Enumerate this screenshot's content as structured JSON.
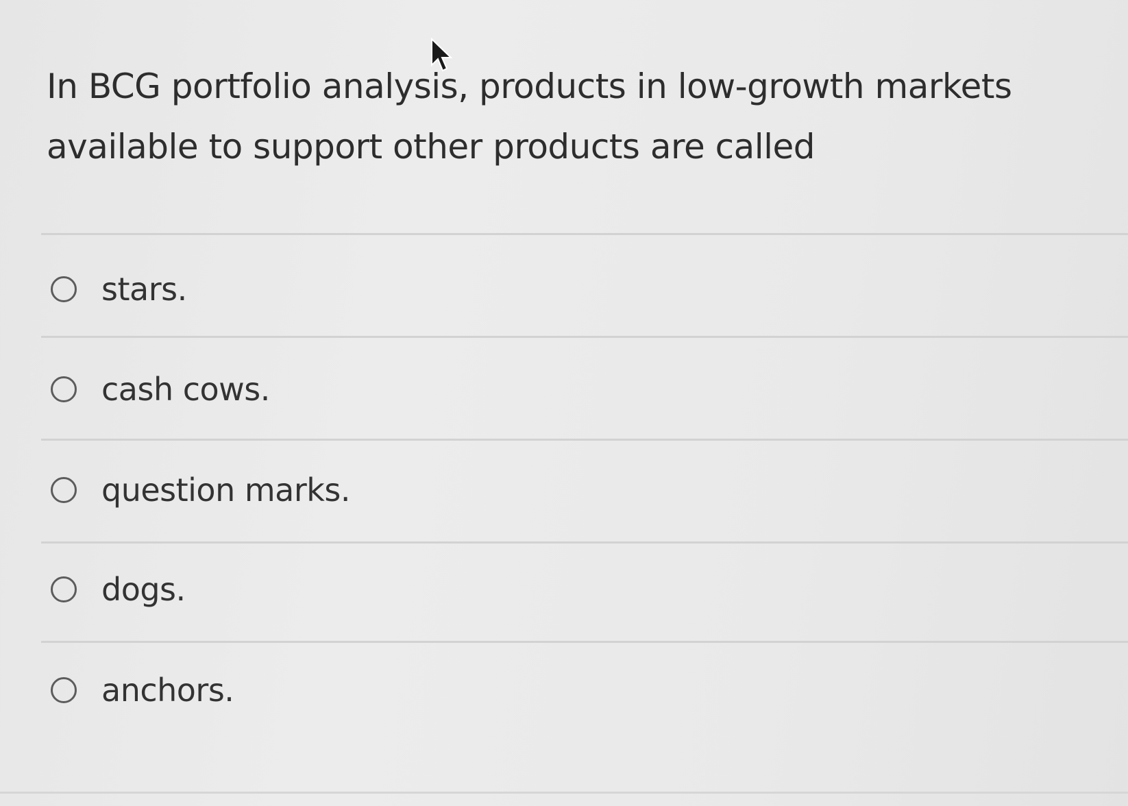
{
  "question": {
    "line1": "In BCG portfolio analysis, products in low-growth markets",
    "line2": "available to support other products are called"
  },
  "options": [
    {
      "label": "stars."
    },
    {
      "label": "cash cows."
    },
    {
      "label": "question marks."
    },
    {
      "label": "dogs."
    },
    {
      "label": "anchors."
    }
  ],
  "icons": {
    "cursor": "mouse-pointer-icon",
    "radio": "radio-unselected-icon"
  }
}
